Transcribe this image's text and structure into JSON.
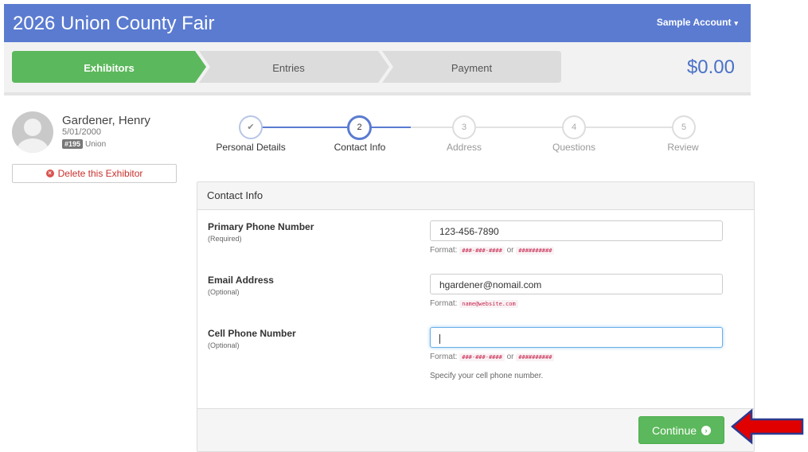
{
  "header": {
    "title": "2026 Union County Fair",
    "account_label": "Sample Account",
    "account_caret": "▾"
  },
  "cart_steps": [
    {
      "label": "Exhibitors"
    },
    {
      "label": "Entries"
    },
    {
      "label": "Payment"
    }
  ],
  "cart_total": "$0.00",
  "exhibitor": {
    "name": "Gardener, Henry",
    "dob": "5/01/2000",
    "badge": "#195",
    "county": "Union",
    "delete_label": "Delete this Exhibitor"
  },
  "wizard": [
    {
      "number": "✔",
      "label": "Personal Details",
      "state": "done"
    },
    {
      "number": "2",
      "label": "Contact Info",
      "state": "active"
    },
    {
      "number": "3",
      "label": "Address",
      "state": "todo"
    },
    {
      "number": "4",
      "label": "Questions",
      "state": "todo"
    },
    {
      "number": "5",
      "label": "Review",
      "state": "todo"
    }
  ],
  "form": {
    "title": "Contact Info",
    "format_prefix": "Format:",
    "or_word": "or",
    "fields": {
      "primary_phone": {
        "label": "Primary Phone Number",
        "hint": "(Required)",
        "value": "123-456-7890",
        "format1": "###-###-####",
        "format2": "##########"
      },
      "email": {
        "label": "Email Address",
        "hint": "(Optional)",
        "value": "hgardener@nomail.com",
        "format1": "name@website.com"
      },
      "cell_phone": {
        "label": "Cell Phone Number",
        "hint": "(Optional)",
        "value": "",
        "format1": "###-###-####",
        "format2": "##########",
        "help": "Specify your cell phone number."
      }
    },
    "continue_label": "Continue"
  },
  "colors": {
    "brand": "#5a7bd0",
    "success": "#5cb85c",
    "danger": "#d9534f",
    "arrow": "#e00000"
  }
}
